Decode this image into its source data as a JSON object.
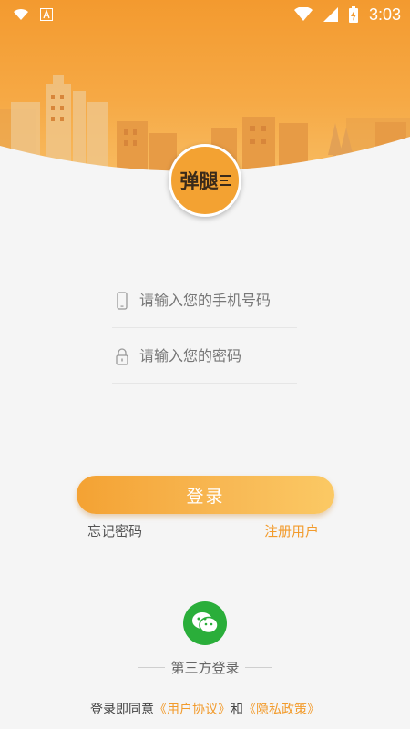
{
  "status_bar": {
    "time": "3:03",
    "left_icons": [
      "wifi-icon",
      "app-notification-icon"
    ],
    "right_icons": [
      "signal-icon",
      "cell-signal-icon",
      "battery-charging-icon"
    ]
  },
  "logo": {
    "text": "弹腿"
  },
  "form": {
    "phone": {
      "placeholder": "请输入您的手机号码",
      "value": "",
      "icon": "phone-icon"
    },
    "password": {
      "placeholder": "请输入您的密码",
      "value": "",
      "icon": "lock-icon"
    }
  },
  "actions": {
    "login_label": "登录",
    "forgot_label": "忘记密码",
    "register_label": "注册用户"
  },
  "third_party": {
    "icon": "wechat-icon",
    "label": "第三方登录"
  },
  "agreement": {
    "prefix": "登录即同意",
    "user_agreement": "《用户协议》",
    "and": "和",
    "privacy_policy": "《隐私政策》"
  },
  "colors": {
    "accent": "#f29b2c",
    "header_top": "#f39a2f",
    "wechat": "#2aae3a"
  }
}
